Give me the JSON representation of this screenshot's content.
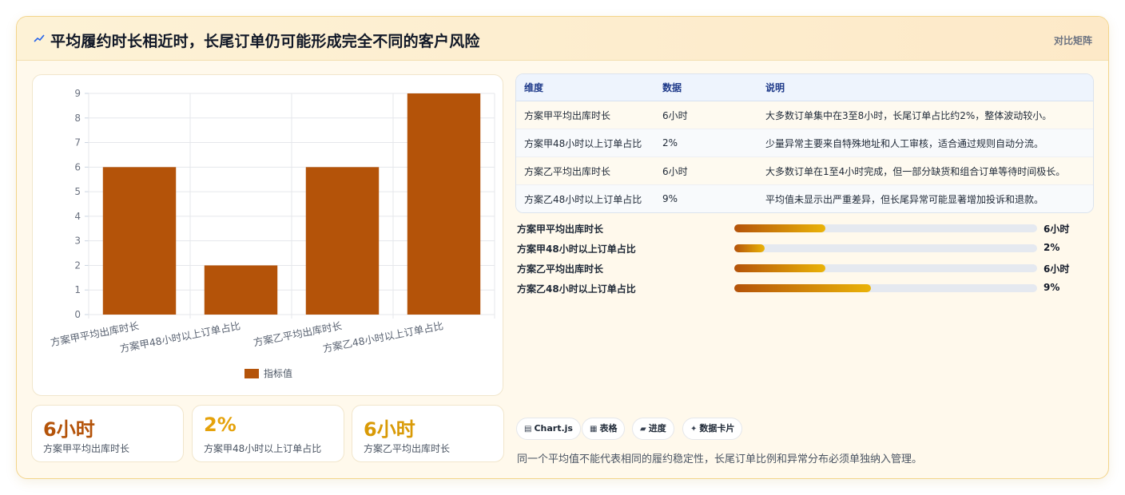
{
  "header": {
    "title": "平均履约时长相近时，长尾订单仍可能形成完全不同的客户风险",
    "tag": "对比矩阵"
  },
  "chart_data": {
    "type": "bar",
    "categories": [
      "方案甲平均出库时长",
      "方案甲48小时以上订单占比",
      "方案乙平均出库时长",
      "方案乙48小时以上订单占比"
    ],
    "series": [
      {
        "name": "指标值",
        "values": [
          6,
          2,
          6,
          9
        ],
        "color": "#b45309"
      }
    ],
    "ylim": [
      0,
      9
    ],
    "yticks": [
      "0",
      "1",
      "2",
      "3",
      "4",
      "5",
      "6",
      "7",
      "8",
      "9"
    ],
    "legend": "bottom",
    "grid": true
  },
  "kpis": [
    {
      "value": "6小时",
      "label": "方案甲平均出库时长",
      "color": "#b45309"
    },
    {
      "value": "2%",
      "label": "方案甲48小时以上订单占比",
      "color": "#e5a20b"
    },
    {
      "value": "6小时",
      "label": "方案乙平均出库时长",
      "color": "#d99a06"
    }
  ],
  "table": {
    "headers": [
      "维度",
      "数据",
      "说明"
    ],
    "rows": [
      [
        "方案甲平均出库时长",
        "6小时",
        "大多数订单集中在3至8小时，长尾订单占比约2%，整体波动较小。"
      ],
      [
        "方案甲48小时以上订单占比",
        "2%",
        "少量异常主要来自特殊地址和人工审核，适合通过规则自动分流。"
      ],
      [
        "方案乙平均出库时长",
        "6小时",
        "大多数订单在1至4小时完成，但一部分缺货和组合订单等待时间极长。"
      ],
      [
        "方案乙48小时以上订单占比",
        "9%",
        "平均值未显示出严重差异，但长尾异常可能显著增加投诉和退款。"
      ]
    ]
  },
  "progress": [
    {
      "label": "方案甲平均出库时长",
      "value": "6小时",
      "fraction": 0.3
    },
    {
      "label": "方案甲48小时以上订单占比",
      "value": "2%",
      "fraction": 0.1
    },
    {
      "label": "方案乙平均出库时长",
      "value": "6小时",
      "fraction": 0.3
    },
    {
      "label": "方案乙48小时以上订单占比",
      "value": "9%",
      "fraction": 0.45
    }
  ],
  "chips": [
    {
      "icon": "▤",
      "label": "Chart.js"
    },
    {
      "icon": "▦",
      "label": "表格"
    },
    {
      "icon": "▰",
      "label": "进度"
    },
    {
      "icon": "✦",
      "label": "数据卡片"
    }
  ],
  "footnote": "同一个平均值不能代表相同的履约稳定性，长尾订单比例和异常分布必须单独纳入管理。"
}
